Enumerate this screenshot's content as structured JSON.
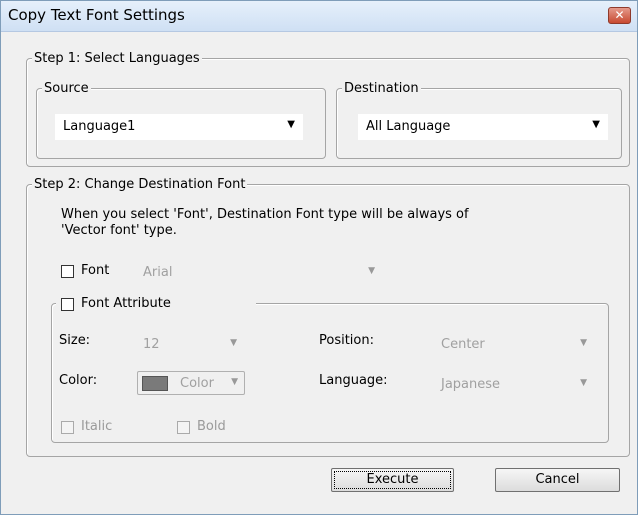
{
  "window": {
    "title": "Copy Text Font Settings",
    "close_glyph": "✕"
  },
  "step1": {
    "legend": "Step 1: Select Languages",
    "source": {
      "legend": "Source",
      "value": "Language1"
    },
    "destination": {
      "legend": "Destination",
      "value": "All Language"
    }
  },
  "step2": {
    "legend": "Step 2: Change Destination Font",
    "note_line1": "When you select 'Font', Destination Font type will be always of",
    "note_line2": "'Vector font' type.",
    "font": {
      "label": "Font",
      "checked": false,
      "value": "Arial"
    },
    "attribute": {
      "label": "Font Attribute",
      "checked": false,
      "size_label": "Size:",
      "size_value": "12",
      "position_label": "Position:",
      "position_value": "Center",
      "color_label": "Color:",
      "color_value": "Color",
      "color_swatch": "#7a7a7a",
      "language_label": "Language:",
      "language_value": "Japanese",
      "italic_label": "Italic",
      "bold_label": "Bold"
    }
  },
  "buttons": {
    "execute": "Execute",
    "cancel": "Cancel"
  },
  "icons": {
    "dropdown": "chevron-down-icon",
    "close": "close-icon"
  },
  "colors": {
    "accent_close": "#c84a31",
    "dialog_bg": "#f0f0f0"
  }
}
